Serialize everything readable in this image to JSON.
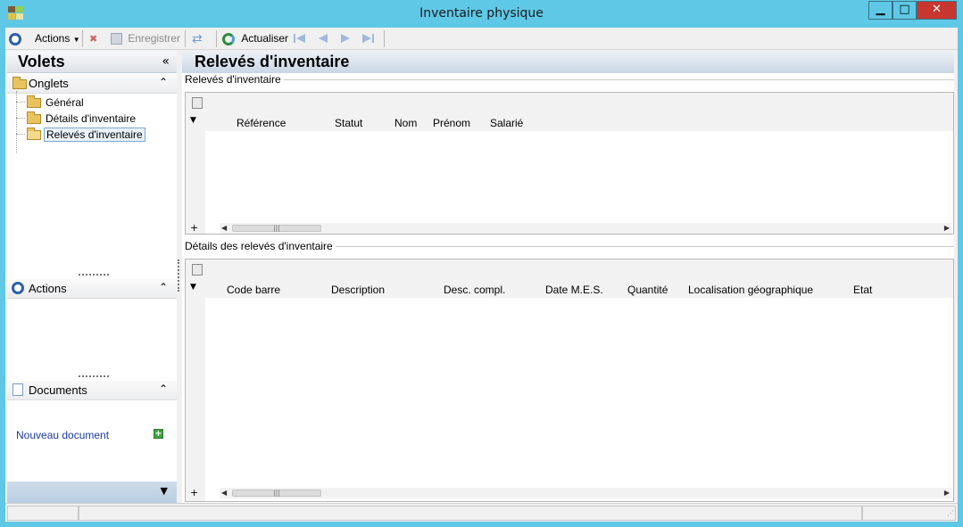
{
  "window": {
    "title": "Inventaire physique",
    "minimize_label": "▁",
    "maximize_label": "□",
    "close_label": "✕"
  },
  "toolbar": {
    "actions_label": "Actions",
    "save_label": "Enregistrer",
    "refresh_label": "Actualiser"
  },
  "left_panel": {
    "title": "Volets",
    "collapse_glyph": "«",
    "onglets": {
      "label": "Onglets",
      "items": [
        {
          "label": "Général"
        },
        {
          "label": "Détails d'inventaire"
        },
        {
          "label": "Relevés d'inventaire",
          "selected": true
        }
      ]
    },
    "actions": {
      "label": "Actions"
    },
    "documents": {
      "label": "Documents",
      "new_document": "Nouveau document"
    }
  },
  "main": {
    "title": "Relevés d'inventaire",
    "group1": {
      "title": "Relevés d'inventaire",
      "columns": [
        "Référence",
        "Statut",
        "Nom",
        "Prénom",
        "Salarié"
      ]
    },
    "group2": {
      "title": "Détails des relevés d'inventaire",
      "columns": [
        "Code barre",
        "Description",
        "Desc. compl.",
        "Date M.E.S.",
        "Quantité",
        "Localisation géographique",
        "Etat"
      ]
    }
  },
  "colors": {
    "window_frame": "#5fc8e6",
    "close_button": "#c7372f",
    "link": "#1a3a9e"
  }
}
